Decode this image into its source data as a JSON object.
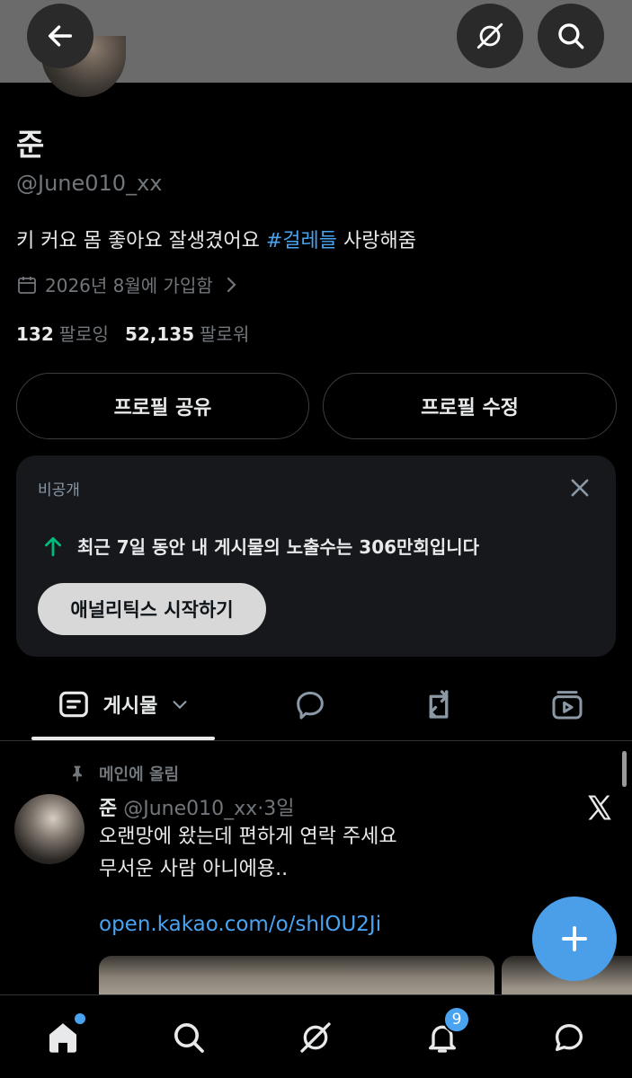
{
  "header": {
    "back_icon": "back-arrow-icon",
    "grok_icon": "grok-icon",
    "search_icon": "search-icon",
    "bar_color": "#6b6b6b"
  },
  "profile": {
    "name": "준",
    "handle": "@June010_xx",
    "bio_before": "키 커요 몸 좋아요 잘생겼어요 ",
    "bio_hashtag": "#걸레들",
    "bio_after": " 사랑해줌",
    "joined": "2026년 8월에 가입함",
    "following_count": "132",
    "following_label": "팔로잉",
    "followers_count": "52,135",
    "followers_label": "팔로워",
    "share_button": "프로필 공유",
    "edit_button": "프로필 수정"
  },
  "analytics_card": {
    "label": "비공개",
    "stat_text": "최근 7일 동안 내 게시물의 노출수는 306만회입니다",
    "button": "애널리틱스 시작하기",
    "accent_color": "#00ba7c"
  },
  "tabs": {
    "posts_label": "게시물",
    "items": [
      "posts-tab",
      "replies-tab",
      "reposts-tab",
      "media-tab"
    ]
  },
  "post": {
    "pinned_label": "메인에 올림",
    "author_name": "준",
    "author_handle": "@June010_xx",
    "separator": "·",
    "time": "3일",
    "line1": "오랜망에 왔는데 편하게 연락 주세요",
    "line2": "무서운 사람 아니에용..",
    "link": "open.kakao.com/o/shlOU2Ji"
  },
  "compose": {
    "icon": "plus-icon",
    "color": "#4a9fe8"
  },
  "bottom_nav": {
    "items": [
      "home-icon",
      "search-icon",
      "grok-icon",
      "notifications-icon",
      "messages-icon"
    ],
    "notifications_badge": "9"
  }
}
